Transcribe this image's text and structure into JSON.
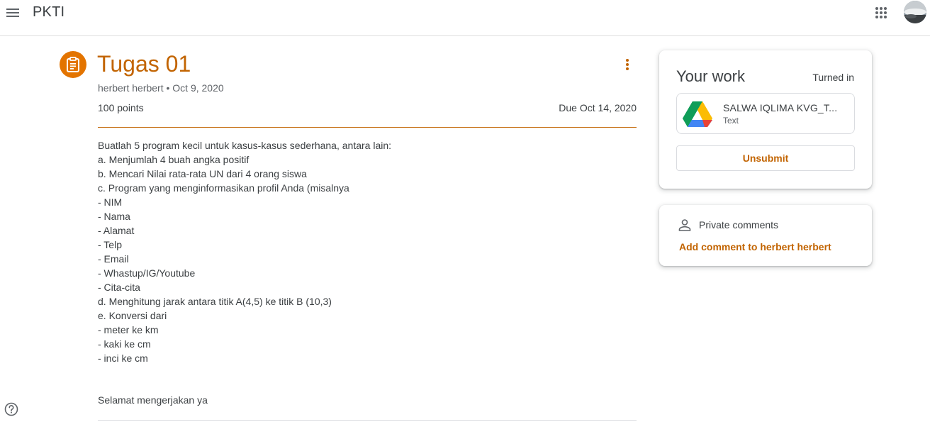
{
  "header": {
    "class_name": "PKTI",
    "icons": {
      "menu": "menu-icon",
      "apps": "apps-grid-icon",
      "avatar": "user-avatar"
    }
  },
  "assignment": {
    "icon": "assignment-icon",
    "title": "Tugas 01",
    "author": "herbert herbert",
    "posted": "Oct 9, 2020",
    "meta": "herbert herbert • Oct 9, 2020",
    "points": "100 points",
    "due": "Due Oct 14, 2020",
    "description_lines": [
      "Buatlah 5 program kecil untuk kasus-kasus sederhana, antara lain:",
      "a. Menjumlah 4 buah angka positif",
      "b. Mencari Nilai rata-rata UN dari 4 orang siswa",
      "c. Program yang menginformasikan profil Anda (misalnya",
      "- NIM",
      "- Nama",
      "- Alamat",
      "- Telp",
      "- Email",
      "- Whastup/IG/Youtube",
      "- Cita-cita",
      "d. Menghitung jarak antara titik A(4,5) ke titik B (10,3)",
      "e. Konversi dari",
      "- meter ke km",
      "- kaki ke cm",
      "- inci ke cm"
    ],
    "closing": "Selamat mengerjakan ya"
  },
  "your_work": {
    "title": "Your work",
    "status": "Turned in",
    "attachment": {
      "name": "SALWA IQLIMA KVG_T...",
      "type": "Text",
      "icon": "google-drive-icon"
    },
    "unsubmit_label": "Unsubmit"
  },
  "private_comments": {
    "title": "Private comments",
    "add_label": "Add comment to herbert herbert"
  },
  "colors": {
    "accent": "#c26401",
    "accent_icon_bg": "#e37400",
    "text": "#3c4043",
    "muted": "#5f6368",
    "border": "#dadce0"
  }
}
